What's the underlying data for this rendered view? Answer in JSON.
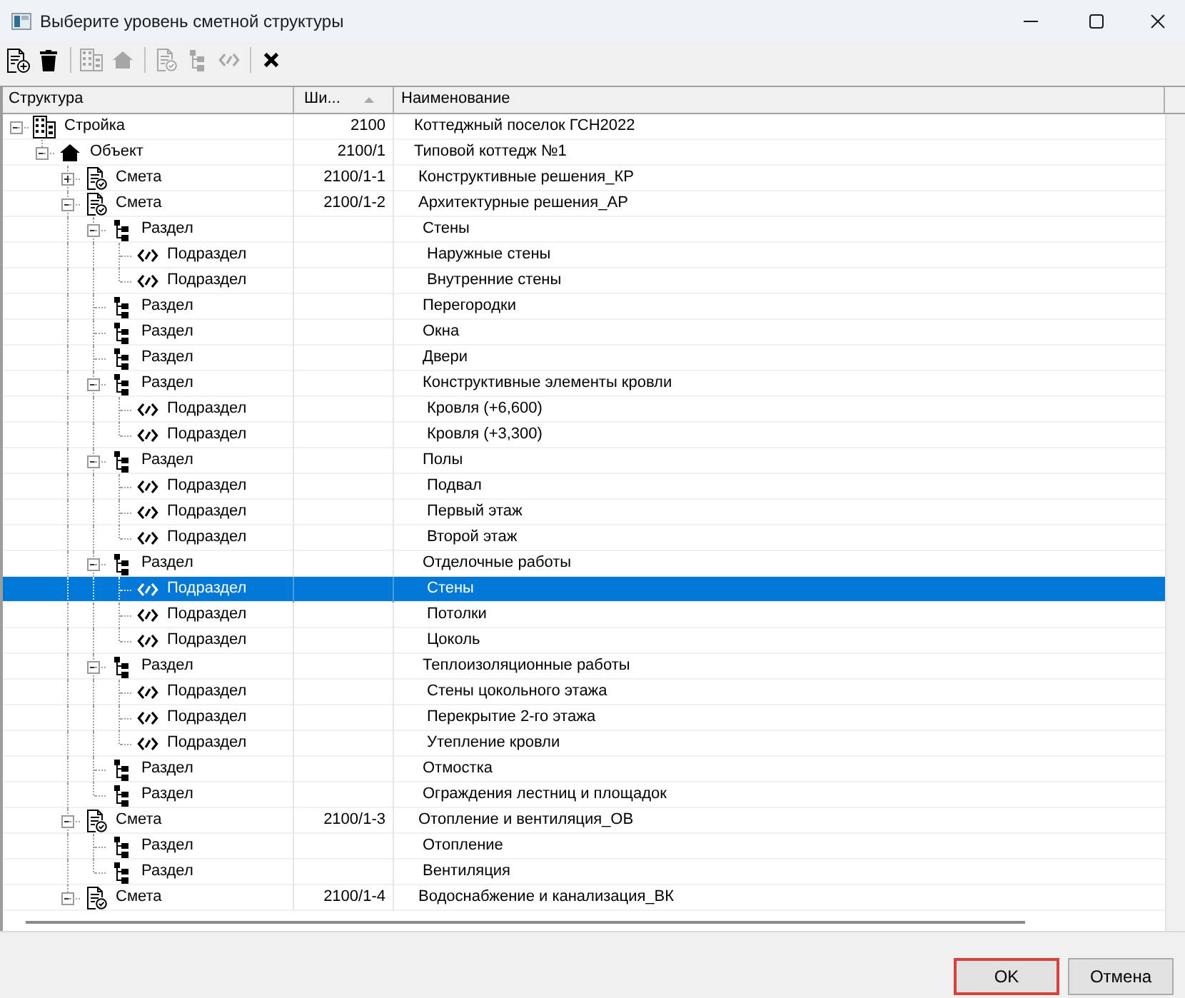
{
  "window": {
    "title": "Выберите уровень сметной структуры"
  },
  "toolbar": {
    "groups": [
      {
        "buttons": [
          {
            "disabled": false
          },
          {
            "disabled": false
          }
        ]
      },
      {
        "buttons": [
          {
            "disabled": true
          },
          {
            "disabled": true
          }
        ]
      },
      {
        "buttons": [
          {
            "disabled": true
          },
          {
            "disabled": true
          },
          {
            "disabled": true
          }
        ]
      },
      {
        "buttons": [
          {
            "disabled": false
          }
        ]
      }
    ]
  },
  "tree": {
    "columns": [
      {
        "label": "Структура",
        "sorted": false
      },
      {
        "label": "Ши...",
        "sorted": true
      },
      {
        "label": "Наименование",
        "sorted": false
      }
    ],
    "nodes": [
      {
        "kind": "construction",
        "label": "Стройка",
        "code": "2100",
        "name": "Коттеджный поселок ГСН2022",
        "expanded": true,
        "selected": false,
        "children": [
          {
            "kind": "object",
            "label": "Объект",
            "code": "2100/1",
            "name": "Типовой коттедж №1",
            "expanded": true,
            "selected": false,
            "children": [
              {
                "kind": "estimate",
                "label": "Смета",
                "code": "2100/1-1",
                "name": "Конструктивные решения_КР",
                "expanded": false,
                "selected": false
              },
              {
                "kind": "estimate",
                "label": "Смета",
                "code": "2100/1-2",
                "name": "Архитектурные решения_АР",
                "expanded": true,
                "selected": false,
                "children": [
                  {
                    "kind": "section",
                    "label": "Раздел",
                    "name": "Стены",
                    "expanded": true,
                    "selected": false,
                    "children": [
                      {
                        "kind": "subsection",
                        "label": "Подраздел",
                        "name": "Наружные стены",
                        "selected": false
                      },
                      {
                        "kind": "subsection",
                        "label": "Подраздел",
                        "name": "Внутренние стены",
                        "selected": false
                      }
                    ]
                  },
                  {
                    "kind": "section",
                    "label": "Раздел",
                    "name": "Перегородки",
                    "selected": false
                  },
                  {
                    "kind": "section",
                    "label": "Раздел",
                    "name": "Окна",
                    "selected": false
                  },
                  {
                    "kind": "section",
                    "label": "Раздел",
                    "name": "Двери",
                    "selected": false
                  },
                  {
                    "kind": "section",
                    "label": "Раздел",
                    "name": "Конструктивные элементы кровли",
                    "expanded": true,
                    "selected": false,
                    "children": [
                      {
                        "kind": "subsection",
                        "label": "Подраздел",
                        "name": "Кровля (+6,600)",
                        "selected": false
                      },
                      {
                        "kind": "subsection",
                        "label": "Подраздел",
                        "name": "Кровля (+3,300)",
                        "selected": false
                      }
                    ]
                  },
                  {
                    "kind": "section",
                    "label": "Раздел",
                    "name": "Полы",
                    "expanded": true,
                    "selected": false,
                    "children": [
                      {
                        "kind": "subsection",
                        "label": "Подраздел",
                        "name": "Подвал",
                        "selected": false
                      },
                      {
                        "kind": "subsection",
                        "label": "Подраздел",
                        "name": "Первый этаж",
                        "selected": false
                      },
                      {
                        "kind": "subsection",
                        "label": "Подраздел",
                        "name": "Второй этаж",
                        "selected": false
                      }
                    ]
                  },
                  {
                    "kind": "section",
                    "label": "Раздел",
                    "name": "Отделочные работы",
                    "expanded": true,
                    "selected": false,
                    "children": [
                      {
                        "kind": "subsection",
                        "label": "Подраздел",
                        "name": "Стены",
                        "selected": true
                      },
                      {
                        "kind": "subsection",
                        "label": "Подраздел",
                        "name": "Потолки",
                        "selected": false
                      },
                      {
                        "kind": "subsection",
                        "label": "Подраздел",
                        "name": "Цоколь",
                        "selected": false
                      }
                    ]
                  },
                  {
                    "kind": "section",
                    "label": "Раздел",
                    "name": "Теплоизоляционные работы",
                    "expanded": true,
                    "selected": false,
                    "children": [
                      {
                        "kind": "subsection",
                        "label": "Подраздел",
                        "name": "Стены цокольного этажа",
                        "selected": false
                      },
                      {
                        "kind": "subsection",
                        "label": "Подраздел",
                        "name": "Перекрытие 2-го этажа",
                        "selected": false
                      },
                      {
                        "kind": "subsection",
                        "label": "Подраздел",
                        "name": "Утепление кровли",
                        "selected": false
                      }
                    ]
                  },
                  {
                    "kind": "section",
                    "label": "Раздел",
                    "name": "Отмостка",
                    "selected": false
                  },
                  {
                    "kind": "section",
                    "label": "Раздел",
                    "name": "Ограждения лестниц и площадок",
                    "selected": false
                  }
                ]
              },
              {
                "kind": "estimate",
                "label": "Смета",
                "code": "2100/1-3",
                "name": "Отопление и вентиляция_ОВ",
                "expanded": true,
                "selected": false,
                "children": [
                  {
                    "kind": "section",
                    "label": "Раздел",
                    "name": "Отопление",
                    "selected": false
                  },
                  {
                    "kind": "section",
                    "label": "Раздел",
                    "name": "Вентиляция",
                    "selected": false
                  }
                ]
              },
              {
                "kind": "estimate",
                "label": "Смета",
                "code": "2100/1-4",
                "name": "Водоснабжение и канализация_ВК",
                "expanded": true,
                "selected": false
              }
            ]
          }
        ]
      }
    ]
  },
  "buttons": [
    {
      "label": "OK",
      "highlighted": true
    },
    {
      "label": "Отмена",
      "highlighted": false
    }
  ]
}
